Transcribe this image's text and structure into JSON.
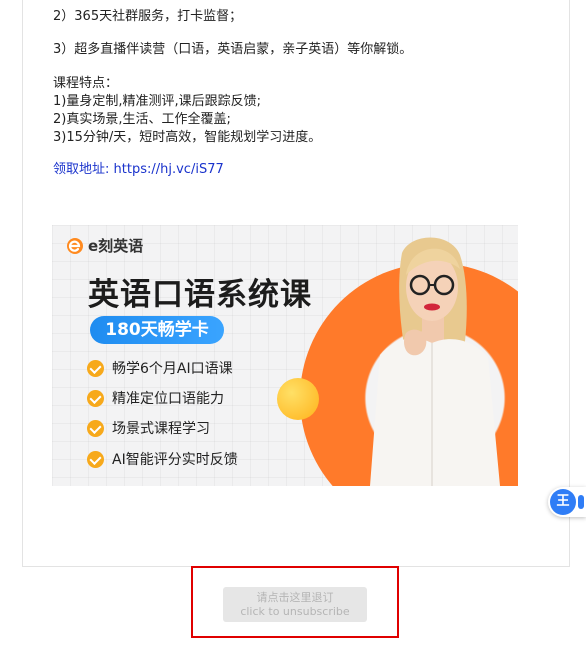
{
  "body_lines": [
    "2）365天社群服务，打卡监督；",
    "3）超多直播伴读营（口语，英语启蒙，亲子英语）等你解锁。",
    "课程特点：",
    "1)量身定制,精准测评,课后跟踪反馈;",
    "2)真实场景,生活、工作全覆盖;",
    "3)15分钟/天，短时高效，智能规划学习进度。"
  ],
  "link": {
    "label": "领取地址:",
    "url": "https://hj.vc/iS77"
  },
  "banner": {
    "brand": "e刻英语",
    "title": "英语口语系统课",
    "pill": "180天畅学卡",
    "features": [
      "畅学6个月AI口语课",
      "精准定位口语能力",
      "场景式课程学习",
      "AI智能评分实时反馈"
    ],
    "accent_orange": "#ff7a2a",
    "accent_blue": "#1f8cf0",
    "check_color": "#f7a91b"
  },
  "float_badge": {
    "glyph": "王",
    "icon": "assistant-badge-icon"
  },
  "unsubscribe": {
    "line1": "请点击这里退订",
    "line2": "click to unsubscribe",
    "frame_color": "#e00000"
  }
}
